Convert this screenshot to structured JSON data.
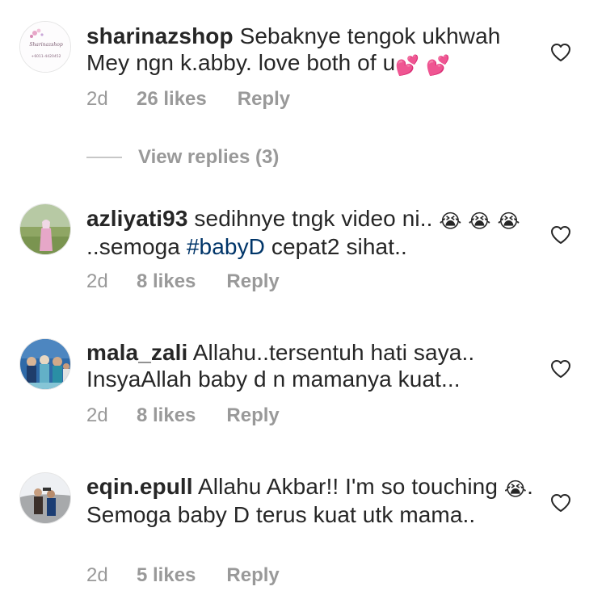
{
  "comments": [
    {
      "username": "sharinazshop",
      "text": "Sebaknye tengok ukhwah Mey ngn k.abby. love both of u",
      "emoji_after": [
        "💕",
        "💕"
      ],
      "age": "2d",
      "likes": "26 likes",
      "reply": "Reply",
      "avatar_text_1": "Sharinazshop",
      "avatar_text_2": "+6011-4420452"
    },
    {
      "username": "azliyati93",
      "text_a": "sedihnye tngk video ni..",
      "emoji_a": [
        "😭",
        "😭"
      ],
      "emoji_b": "😭",
      "text_b": "..semoga",
      "hashtag": "#babyD",
      "text_c": "cepat2 sihat..",
      "age": "2d",
      "likes": "8 likes",
      "reply": "Reply"
    },
    {
      "username": "mala_zali",
      "text": "Allahu..tersentuh hati saya.. InsyaAllah baby d n mamanya kuat...",
      "age": "2d",
      "likes": "8 likes",
      "reply": "Reply"
    },
    {
      "username": "eqin.epull",
      "text_a": "Allahu Akbar!! I'm so touching",
      "emoji": "😭",
      "text_b": ". Semoga baby D terus kuat utk mama..",
      "age": "2d",
      "likes": "5 likes",
      "reply": "Reply"
    }
  ],
  "view_replies": "View replies (3)",
  "colors": {
    "text": "#262626",
    "muted": "#999999",
    "hashtag": "#003569"
  },
  "icons": [
    "heart-icon"
  ]
}
